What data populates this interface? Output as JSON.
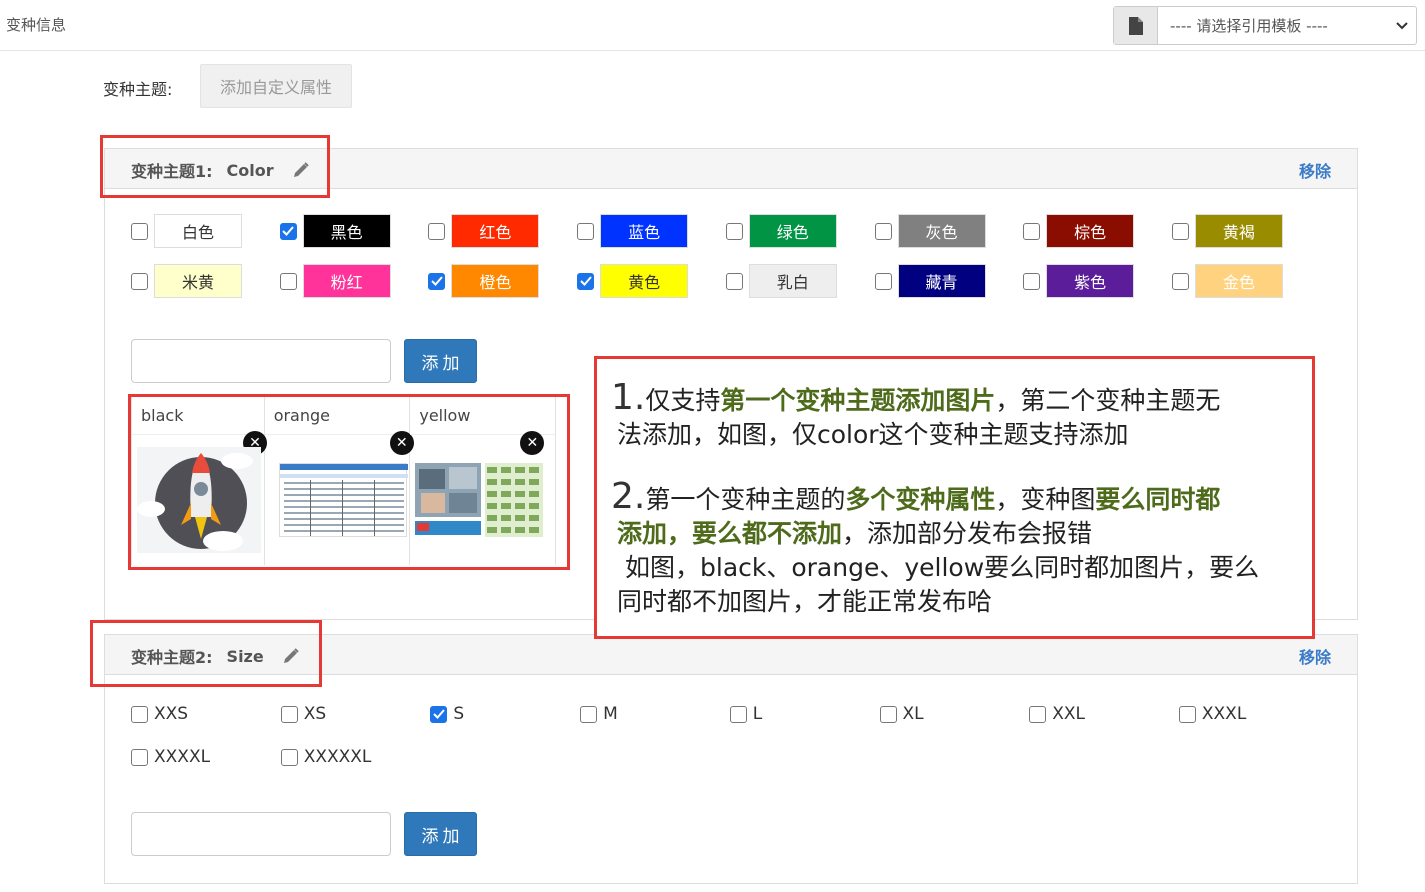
{
  "header": {
    "title": "变种信息",
    "template_select": "---- 请选择引用模板 ----"
  },
  "variant_theme": {
    "label": "变种主题:",
    "add_attr_button": "添加自定义属性"
  },
  "panel1": {
    "title_prefix": "变种主题1:",
    "title_name": "Color",
    "remove": "移除",
    "colors": [
      {
        "label": "白色",
        "bg": "#ffffff",
        "fg": "#333333",
        "checked": false
      },
      {
        "label": "黑色",
        "bg": "#000000",
        "fg": "#ffffff",
        "checked": true
      },
      {
        "label": "红色",
        "bg": "#ff2a00",
        "fg": "#ffffff",
        "checked": false
      },
      {
        "label": "蓝色",
        "bg": "#0033ff",
        "fg": "#ffffff",
        "checked": false
      },
      {
        "label": "绿色",
        "bg": "#009444",
        "fg": "#ffffff",
        "checked": false
      },
      {
        "label": "灰色",
        "bg": "#808080",
        "fg": "#ffffff",
        "checked": false
      },
      {
        "label": "棕色",
        "bg": "#8b0c00",
        "fg": "#ffffff",
        "checked": false
      },
      {
        "label": "黄褐",
        "bg": "#9a8c00",
        "fg": "#ffffff",
        "checked": false
      },
      {
        "label": "米黄",
        "bg": "#ffffcc",
        "fg": "#333333",
        "checked": false
      },
      {
        "label": "粉红",
        "bg": "#ff3399",
        "fg": "#ffffff",
        "checked": false
      },
      {
        "label": "橙色",
        "bg": "#ff8800",
        "fg": "#ffffff",
        "checked": true
      },
      {
        "label": "黄色",
        "bg": "#ffff00",
        "fg": "#333333",
        "checked": true
      },
      {
        "label": "乳白",
        "bg": "#eeeeee",
        "fg": "#333333",
        "checked": false
      },
      {
        "label": "藏青",
        "bg": "#000080",
        "fg": "#ffffff",
        "checked": false
      },
      {
        "label": "紫色",
        "bg": "#5b1d99",
        "fg": "#ffffff",
        "checked": false
      },
      {
        "label": "金色",
        "bg": "#ffd27f",
        "fg": "#ffffff",
        "checked": false
      }
    ],
    "add_button": "添加",
    "images": [
      {
        "label": "black",
        "thumb": "rocket-illustration"
      },
      {
        "label": "orange",
        "thumb": "spreadsheet-screenshot"
      },
      {
        "label": "yellow",
        "thumb": "product-collage"
      }
    ]
  },
  "panel2": {
    "title_prefix": "变种主题2:",
    "title_name": "Size",
    "remove": "移除",
    "sizes": [
      {
        "label": "XXS",
        "checked": false
      },
      {
        "label": "XS",
        "checked": false
      },
      {
        "label": "S",
        "checked": true
      },
      {
        "label": "M",
        "checked": false
      },
      {
        "label": "L",
        "checked": false
      },
      {
        "label": "XL",
        "checked": false
      },
      {
        "label": "XXL",
        "checked": false
      },
      {
        "label": "XXXL",
        "checked": false
      },
      {
        "label": "XXXXL",
        "checked": false
      },
      {
        "label": "XXXXXL",
        "checked": false
      }
    ],
    "add_button": "添加"
  },
  "annotation": {
    "n1": "1.",
    "l1a": "仅支持",
    "l1b": "第一个变种主题添加图片",
    "l1c": "，第二个变种主题无",
    "l1d": "法添加，如图，仅color这个变种主题支持添加",
    "n2": "2.",
    "l2a": "第一个变种主题的",
    "l2b": "多个变种属性",
    "l2c": "，变种图",
    "l2d": "要么同时都",
    "l2e": "添加，要么都不添加",
    "l2f": "，添加部分发布会报错",
    "l2g": "如图，black、orange、yellow要么同时都加图片，要么",
    "l2h": "同时都不加图片，才能正常发布哈"
  },
  "colors": {
    "accent": "#2f78b9",
    "check": "#1a73e8",
    "annotation_border": "#e53935",
    "highlight_text": "#4e6b1c"
  }
}
